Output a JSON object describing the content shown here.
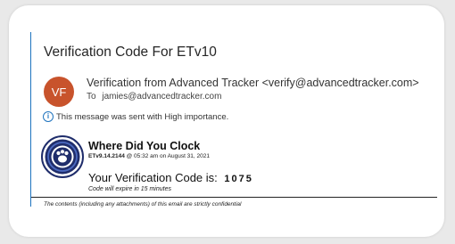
{
  "email": {
    "subject": "Verification Code For ETv10",
    "sender_initials": "VF",
    "from": "Verification from Advanced Tracker <verify@advancedtracker.com>",
    "to_label": "To",
    "to_address": "jamies@advancedtracker.com",
    "importance_note": "This message was sent with High importance."
  },
  "body": {
    "brand_title": "Where Did You Clock",
    "version": "ETv9.14.2144",
    "timestamp": "@ 05:32 am on August 31, 2021",
    "code_label": "Your Verification Code is:",
    "code_value": "1075",
    "expiry_note": "Code will expire in 15 minutes",
    "disclaimer": "The contents (including any attachments) of this email are strictly confidential"
  },
  "colors": {
    "accent_blue": "#1e73be",
    "avatar_bg": "#c8532c",
    "logo_navy": "#1f2d6b"
  },
  "icons": {
    "info": "info-icon",
    "logo": "paw-logo-icon"
  }
}
